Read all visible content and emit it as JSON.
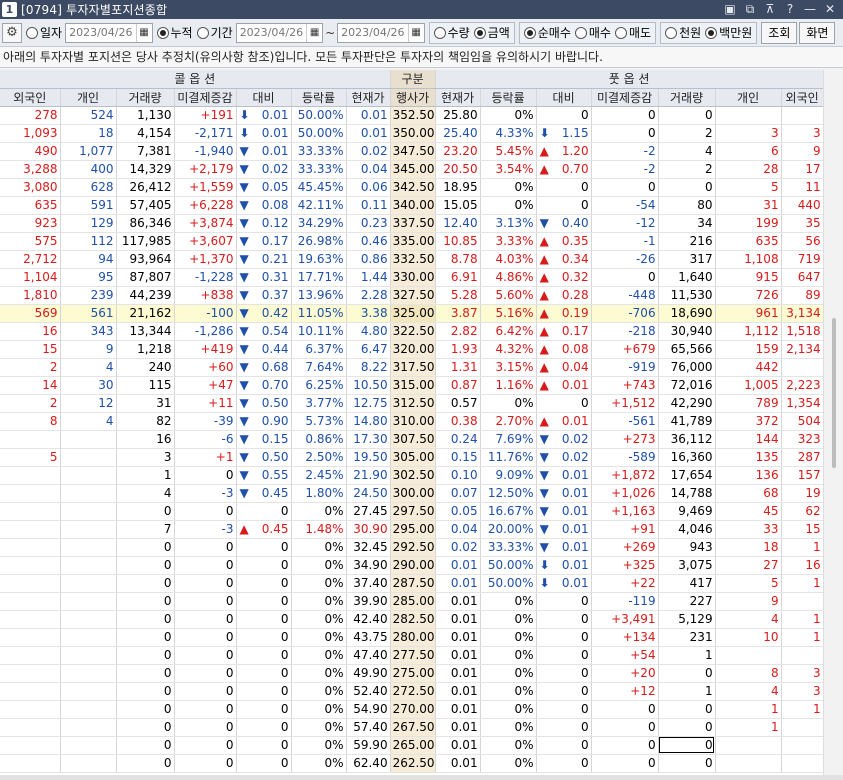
{
  "window": {
    "number": "1",
    "title": "[0794] 투자자별포지션종합",
    "controls": [
      "▣",
      "⧉",
      "⊼",
      "?",
      "—",
      "✕"
    ]
  },
  "toolbar": {
    "radio_date": "일자",
    "date_single": "2023/04/26",
    "radio_cumul": "누적",
    "radio_period": "기간",
    "date_from": "2023/04/26",
    "tilde": "~",
    "date_to": "2023/04/26",
    "radio_qty": "수량",
    "radio_amount": "금액",
    "radio_netbuy": "순매수",
    "radio_buy": "매수",
    "radio_sell": "매도",
    "radio_won": "천원",
    "radio_million": "백만원",
    "search_btn": "조회",
    "screen_btn": "화면"
  },
  "notice": "아래의 투자자별 포지션은 당사 추정치(유의사항 참조)입니다. 모든 투자판단은 투자자의 책임임을 유의하시기 바랍니다.",
  "headers": {
    "call": "콜 옵 션",
    "kind": "구분",
    "put": "풋 옵 션",
    "call_cols": [
      "외국인",
      "개인",
      "거래량",
      "미결제증감",
      "대비",
      "등락률",
      "현재가"
    ],
    "kind_col": "행사가",
    "put_cols": [
      "현재가",
      "등락률",
      "대비",
      "미결제증감",
      "거래량",
      "개인",
      "외국인"
    ]
  },
  "rows": [
    {
      "c": [
        "278",
        "524",
        "1,130",
        "+191",
        "dn|0.01",
        "50.00%",
        "0.01"
      ],
      "k": "352.50",
      "p": [
        "25.80",
        "0%",
        "|0",
        "0",
        "0",
        "",
        ""
      ]
    },
    {
      "c": [
        "1,093",
        "18",
        "4,154",
        "-2,171",
        "dn|0.01",
        "50.00%",
        "0.01"
      ],
      "k": "350.00",
      "p": [
        "25.40",
        "4.33%",
        "dn|1.15",
        "0",
        "2",
        "3",
        "3"
      ]
    },
    {
      "c": [
        "490",
        "1,077",
        "7,381",
        "-1,940",
        "tri|0.01",
        "33.33%",
        "0.02"
      ],
      "k": "347.50",
      "p": [
        "23.20",
        "5.45%",
        "up|1.20",
        "-2",
        "4",
        "6",
        "9"
      ]
    },
    {
      "c": [
        "3,288",
        "400",
        "14,329",
        "+2,179",
        "tri|0.02",
        "33.33%",
        "0.04"
      ],
      "k": "345.00",
      "p": [
        "20.50",
        "3.54%",
        "up|0.70",
        "-2",
        "2",
        "28",
        "17"
      ]
    },
    {
      "c": [
        "3,080",
        "628",
        "26,412",
        "+1,559",
        "tri|0.05",
        "45.45%",
        "0.06"
      ],
      "k": "342.50",
      "p": [
        "18.95",
        "0%",
        "|0",
        "0",
        "0",
        "5",
        "11"
      ]
    },
    {
      "c": [
        "635",
        "591",
        "57,405",
        "+6,228",
        "tri|0.08",
        "42.11%",
        "0.11"
      ],
      "k": "340.00",
      "p": [
        "15.05",
        "0%",
        "|0",
        "-54",
        "80",
        "31",
        "440"
      ]
    },
    {
      "c": [
        "923",
        "129",
        "86,346",
        "+3,874",
        "tri|0.12",
        "34.29%",
        "0.23"
      ],
      "k": "337.50",
      "p": [
        "12.40",
        "3.13%",
        "tri|0.40",
        "-12",
        "34",
        "199",
        "35"
      ]
    },
    {
      "c": [
        "575",
        "112",
        "117,985",
        "+3,607",
        "tri|0.17",
        "26.98%",
        "0.46"
      ],
      "k": "335.00",
      "p": [
        "10.85",
        "3.33%",
        "up|0.35",
        "-1",
        "216",
        "635",
        "56"
      ]
    },
    {
      "c": [
        "2,712",
        "94",
        "93,964",
        "+1,370",
        "tri|0.21",
        "19.63%",
        "0.86"
      ],
      "k": "332.50",
      "p": [
        "8.78",
        "4.03%",
        "up|0.34",
        "-26",
        "317",
        "1,108",
        "719"
      ]
    },
    {
      "c": [
        "1,104",
        "95",
        "87,807",
        "-1,228",
        "tri|0.31",
        "17.71%",
        "1.44"
      ],
      "k": "330.00",
      "p": [
        "6.91",
        "4.86%",
        "up|0.32",
        "0",
        "1,640",
        "915",
        "647"
      ]
    },
    {
      "c": [
        "1,810",
        "239",
        "44,239",
        "+838",
        "tri|0.37",
        "13.96%",
        "2.28"
      ],
      "k": "327.50",
      "p": [
        "5.28",
        "5.60%",
        "up|0.28",
        "-448",
        "11,530",
        "726",
        "89"
      ]
    },
    {
      "c": [
        "569",
        "561",
        "21,162",
        "-100",
        "tri|0.42",
        "11.05%",
        "3.38"
      ],
      "k": "325.00",
      "p": [
        "3.87",
        "5.16%",
        "up|0.19",
        "-706",
        "18,690",
        "961",
        "3,134"
      ],
      "hl": true
    },
    {
      "c": [
        "16",
        "343",
        "13,344",
        "-1,286",
        "tri|0.54",
        "10.11%",
        "4.80"
      ],
      "k": "322.50",
      "p": [
        "2.82",
        "6.42%",
        "up|0.17",
        "-218",
        "30,940",
        "1,112",
        "1,518"
      ]
    },
    {
      "c": [
        "15",
        "9",
        "1,218",
        "+419",
        "tri|0.44",
        "6.37%",
        "6.47"
      ],
      "k": "320.00",
      "p": [
        "1.93",
        "4.32%",
        "up|0.08",
        "+679",
        "65,566",
        "159",
        "2,134"
      ]
    },
    {
      "c": [
        "2",
        "4",
        "240",
        "+60",
        "tri|0.68",
        "7.64%",
        "8.22"
      ],
      "k": "317.50",
      "p": [
        "1.31",
        "3.15%",
        "up|0.04",
        "-919",
        "76,000",
        "442",
        ""
      ]
    },
    {
      "c": [
        "14",
        "30",
        "115",
        "+47",
        "tri|0.70",
        "6.25%",
        "10.50"
      ],
      "k": "315.00",
      "p": [
        "0.87",
        "1.16%",
        "up|0.01",
        "+743",
        "72,016",
        "1,005",
        "2,223"
      ]
    },
    {
      "c": [
        "2",
        "12",
        "31",
        "+11",
        "tri|0.50",
        "3.77%",
        "12.75"
      ],
      "k": "312.50",
      "p": [
        "0.57",
        "0%",
        "|0",
        "+1,512",
        "42,290",
        "789",
        "1,354"
      ]
    },
    {
      "c": [
        "8",
        "4",
        "82",
        "-39",
        "tri|0.90",
        "5.73%",
        "14.80"
      ],
      "k": "310.00",
      "p": [
        "0.38",
        "2.70%",
        "up|0.01",
        "-561",
        "41,789",
        "372",
        "504"
      ]
    },
    {
      "c": [
        "",
        "",
        "16",
        "-6",
        "tri|0.15",
        "0.86%",
        "17.30"
      ],
      "k": "307.50",
      "p": [
        "0.24",
        "7.69%",
        "tri|0.02",
        "+273",
        "36,112",
        "144",
        "323"
      ]
    },
    {
      "c": [
        "5",
        "",
        "3",
        "+1",
        "tri|0.50",
        "2.50%",
        "19.50"
      ],
      "k": "305.00",
      "p": [
        "0.15",
        "11.76%",
        "tri|0.02",
        "-589",
        "16,360",
        "135",
        "287"
      ]
    },
    {
      "c": [
        "",
        "",
        "1",
        "0",
        "tri|0.55",
        "2.45%",
        "21.90"
      ],
      "k": "302.50",
      "p": [
        "0.10",
        "9.09%",
        "tri|0.01",
        "+1,872",
        "17,654",
        "136",
        "157"
      ]
    },
    {
      "c": [
        "",
        "",
        "4",
        "-3",
        "tri|0.45",
        "1.80%",
        "24.50"
      ],
      "k": "300.00",
      "p": [
        "0.07",
        "12.50%",
        "tri|0.01",
        "+1,026",
        "14,788",
        "68",
        "19"
      ]
    },
    {
      "c": [
        "",
        "",
        "0",
        "0",
        "|0",
        "0%",
        "27.45"
      ],
      "k": "297.50",
      "p": [
        "0.05",
        "16.67%",
        "tri|0.01",
        "+1,163",
        "9,469",
        "45",
        "62"
      ]
    },
    {
      "c": [
        "",
        "",
        "7",
        "-3",
        "up|0.45",
        "1.48%",
        "30.90"
      ],
      "k": "295.00",
      "p": [
        "0.04",
        "20.00%",
        "tri|0.01",
        "+91",
        "4,046",
        "33",
        "15"
      ]
    },
    {
      "c": [
        "",
        "",
        "0",
        "0",
        "|0",
        "0%",
        "32.45"
      ],
      "k": "292.50",
      "p": [
        "0.02",
        "33.33%",
        "tri|0.01",
        "+269",
        "943",
        "18",
        "1"
      ]
    },
    {
      "c": [
        "",
        "",
        "0",
        "0",
        "|0",
        "0%",
        "34.90"
      ],
      "k": "290.00",
      "p": [
        "0.01",
        "50.00%",
        "dn|0.01",
        "+325",
        "3,075",
        "27",
        "16"
      ]
    },
    {
      "c": [
        "",
        "",
        "0",
        "0",
        "|0",
        "0%",
        "37.40"
      ],
      "k": "287.50",
      "p": [
        "0.01",
        "50.00%",
        "dn|0.01",
        "+22",
        "417",
        "5",
        "1"
      ]
    },
    {
      "c": [
        "",
        "",
        "0",
        "0",
        "|0",
        "0%",
        "39.90"
      ],
      "k": "285.00",
      "p": [
        "0.01",
        "0%",
        "|0",
        "-119",
        "227",
        "9",
        ""
      ]
    },
    {
      "c": [
        "",
        "",
        "0",
        "0",
        "|0",
        "0%",
        "42.40"
      ],
      "k": "282.50",
      "p": [
        "0.01",
        "0%",
        "|0",
        "+3,491",
        "5,129",
        "4",
        "1"
      ]
    },
    {
      "c": [
        "",
        "",
        "0",
        "0",
        "|0",
        "0%",
        "43.75"
      ],
      "k": "280.00",
      "p": [
        "0.01",
        "0%",
        "|0",
        "+134",
        "231",
        "10",
        "1"
      ]
    },
    {
      "c": [
        "",
        "",
        "0",
        "0",
        "|0",
        "0%",
        "47.40"
      ],
      "k": "277.50",
      "p": [
        "0.01",
        "0%",
        "|0",
        "+54",
        "1",
        "",
        ""
      ]
    },
    {
      "c": [
        "",
        "",
        "0",
        "0",
        "|0",
        "0%",
        "49.90"
      ],
      "k": "275.00",
      "p": [
        "0.01",
        "0%",
        "|0",
        "+20",
        "0",
        "8",
        "3"
      ]
    },
    {
      "c": [
        "",
        "",
        "0",
        "0",
        "|0",
        "0%",
        "52.40"
      ],
      "k": "272.50",
      "p": [
        "0.01",
        "0%",
        "|0",
        "+12",
        "1",
        "4",
        "3"
      ]
    },
    {
      "c": [
        "",
        "",
        "0",
        "0",
        "|0",
        "0%",
        "54.90"
      ],
      "k": "270.00",
      "p": [
        "0.01",
        "0%",
        "|0",
        "0",
        "0",
        "1",
        "1"
      ]
    },
    {
      "c": [
        "",
        "",
        "0",
        "0",
        "|0",
        "0%",
        "57.40"
      ],
      "k": "267.50",
      "p": [
        "0.01",
        "0%",
        "|0",
        "0",
        "0",
        "1",
        ""
      ]
    },
    {
      "c": [
        "",
        "",
        "0",
        "0",
        "|0",
        "0%",
        "59.90"
      ],
      "k": "265.00",
      "p": [
        "0.01",
        "0%",
        "|0",
        "0",
        "0",
        "",
        ""
      ]
    },
    {
      "c": [
        "",
        "",
        "0",
        "0",
        "|0",
        "0%",
        "62.40"
      ],
      "k": "262.50",
      "p": [
        "0.01",
        "0%",
        "|0",
        "0",
        "0",
        "",
        ""
      ]
    }
  ],
  "colors": {
    "up": "#d81a1a",
    "down": "#1f4fa8",
    "strike_bg": "#f6ecd8",
    "highlight_row": "#fdfbd2"
  }
}
